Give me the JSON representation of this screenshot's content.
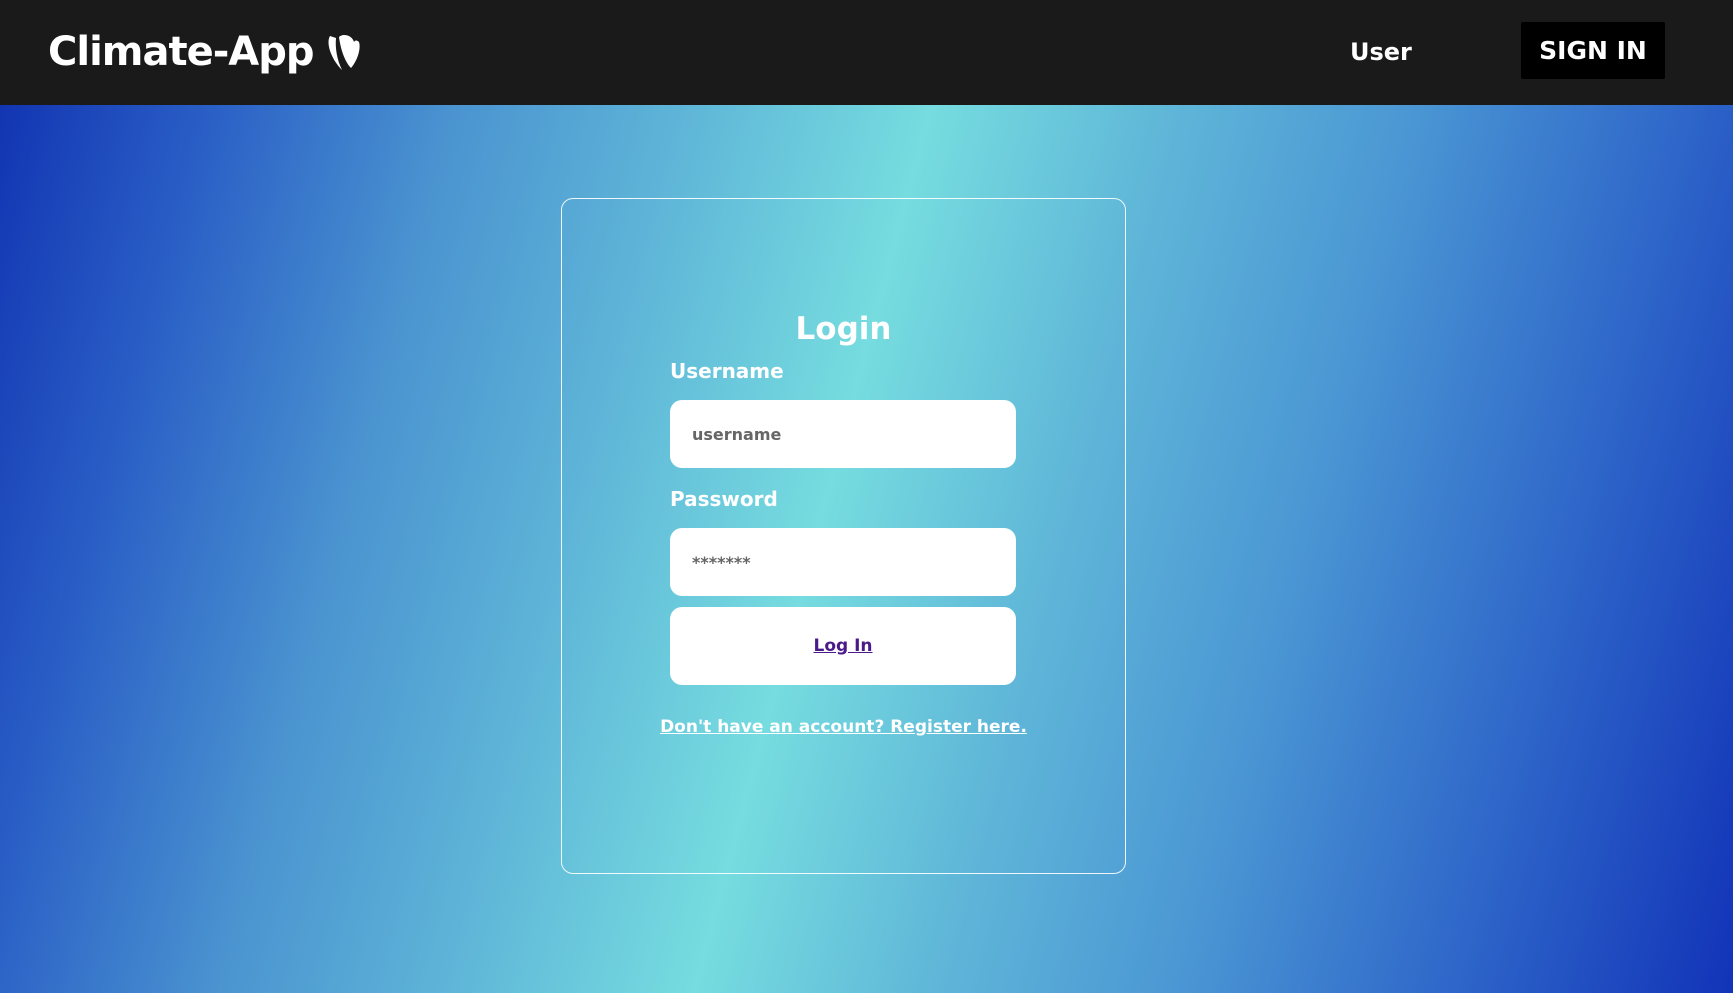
{
  "header": {
    "brand": "Climate-App",
    "brand_icon": "typo3-logo-icon",
    "nav_user": "User",
    "sign_in": "SIGN IN"
  },
  "login": {
    "title": "Login",
    "username_label": "Username",
    "username_placeholder": "username",
    "password_label": "Password",
    "password_placeholder": "*******",
    "submit": "Log In",
    "register": "Don't have an account? Register here."
  },
  "colors": {
    "header_bg": "#1b1a1a",
    "signin_bg": "#000000",
    "gradient_dark": "#1233b8",
    "gradient_light": "#76dcdf",
    "login_link": "#4b1a8a"
  }
}
